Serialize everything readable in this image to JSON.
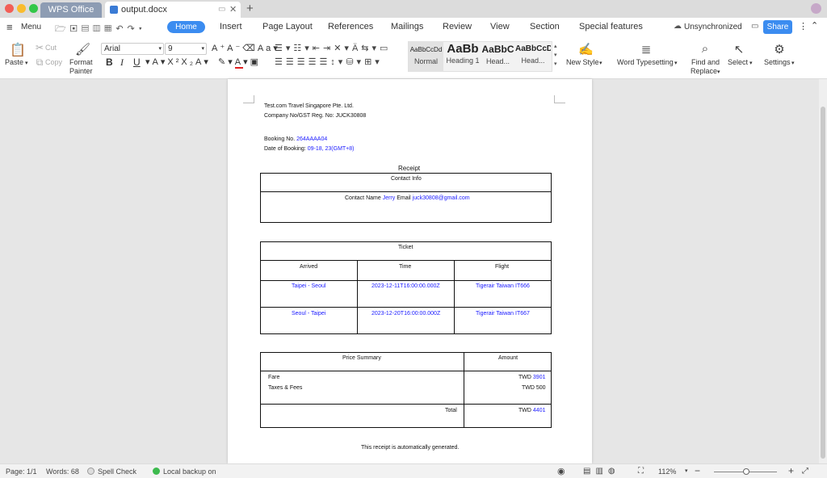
{
  "titlebar": {
    "app_tab": "WPS Office",
    "doc_tab": "output.docx",
    "new_tab": "+"
  },
  "menu": {
    "menu_label": "Menu",
    "tabs": [
      "Home",
      "Insert",
      "Page Layout",
      "References",
      "Mailings",
      "Review",
      "View",
      "Section",
      "Special features"
    ],
    "sync_status": "Unsynchronized",
    "share_label": "Share"
  },
  "ribbon": {
    "paste": "Paste",
    "cut": "Cut",
    "copy": "Copy",
    "format_painter_1": "Format",
    "format_painter_2": "Painter",
    "font_name": "Arial",
    "font_size": "9",
    "styles": [
      {
        "preview": "AaBbCcDd",
        "label": "Normal"
      },
      {
        "preview": "AaBb",
        "label": "Heading 1"
      },
      {
        "preview": "AaBbC",
        "label": "Head..."
      },
      {
        "preview": "AaBbCcD",
        "label": "Head..."
      }
    ],
    "new_style": "New Style",
    "word_typesetting": "Word Typesetting",
    "find_replace_1": "Find and",
    "find_replace_2": "Replace",
    "select": "Select",
    "settings": "Settings"
  },
  "document": {
    "company": "Test.com Travel Singapore Pte. Ltd.",
    "company_reg": "Company No/GST Reg. No: JUCK30808",
    "booking_label": "Booking No.",
    "booking_no": "264AAAA04",
    "date_label": "Date of Booking:",
    "date_value": "09-18, 23(GMT+8)",
    "receipt_title": "Receipt",
    "contact": {
      "header": "Contact Info",
      "name_label": "Contact Name",
      "name": "Jerry",
      "email_label": "Email",
      "email": "juck30808@gmail.com"
    },
    "ticket": {
      "header": "Ticket",
      "columns": [
        "Arrived",
        "Time",
        "Flight"
      ],
      "rows": [
        {
          "route": "Taipei - Seoul",
          "time": "2023-12-11T16:00:00.000Z",
          "flight": "Tigerair Taiwan IT666"
        },
        {
          "route": "Seoul - Taipei",
          "time": "2023-12-20T16:00:00.000Z",
          "flight": "Tigerair Taiwan IT667"
        }
      ]
    },
    "price": {
      "header_summary": "Price Summary",
      "header_amount": "Amount",
      "fare_label": "Fare",
      "fees_label": "Taxes & Fees",
      "fare_currency": "TWD",
      "fare_value": "3901",
      "fees_value": "TWD 500",
      "total_label": "Total",
      "total_currency": "TWD",
      "total_value": "4401"
    },
    "footer_note": "This receipt is automatically generated."
  },
  "status": {
    "page": "Page: 1/1",
    "words": "Words: 68",
    "spell_check": "Spell Check",
    "backup": "Local backup on",
    "zoom": "112%",
    "minus": "−",
    "plus": "+"
  },
  "colors": {
    "accent": "#3b8cf0",
    "link_blue": "#1a1aff",
    "app_tab": "#8d9cb3"
  }
}
